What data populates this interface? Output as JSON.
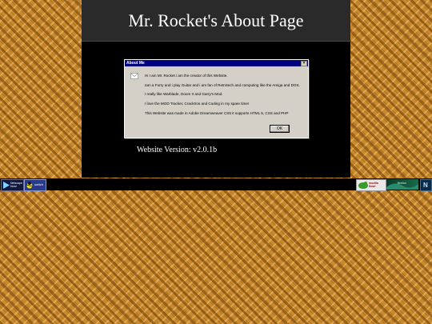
{
  "header": {
    "title": "Mr. Rocket's About Page"
  },
  "dialog": {
    "title": "About Me",
    "close_label": "×",
    "lines": [
      "Hi I am Mr. Rocket i am the creator of this Website.",
      "Iam a Furry and i play Guitar and i am fan of Retrotech and computing like the Amiga and DOS.",
      "I really like Warblade, Doom II and Garry's Mod.",
      "I love the MOD Tracker, Cracktros and Coding in my spare time!",
      "This Website was made in Adobe Dreamweaver CS5 it supports HTML 5, CSS and PHP"
    ],
    "ok_label": "OK"
  },
  "version": {
    "text": "Website Version: v2.0.1b"
  },
  "badges": {
    "left1": "Netscape Now!",
    "left2": "switch",
    "mozilla": "mozilla Now!",
    "firefox": "firefox",
    "n": "N"
  },
  "colors": {
    "title_bar": "#000080",
    "dialog_bg": "#d4d0c8",
    "page_bg": "#c98a2e"
  }
}
